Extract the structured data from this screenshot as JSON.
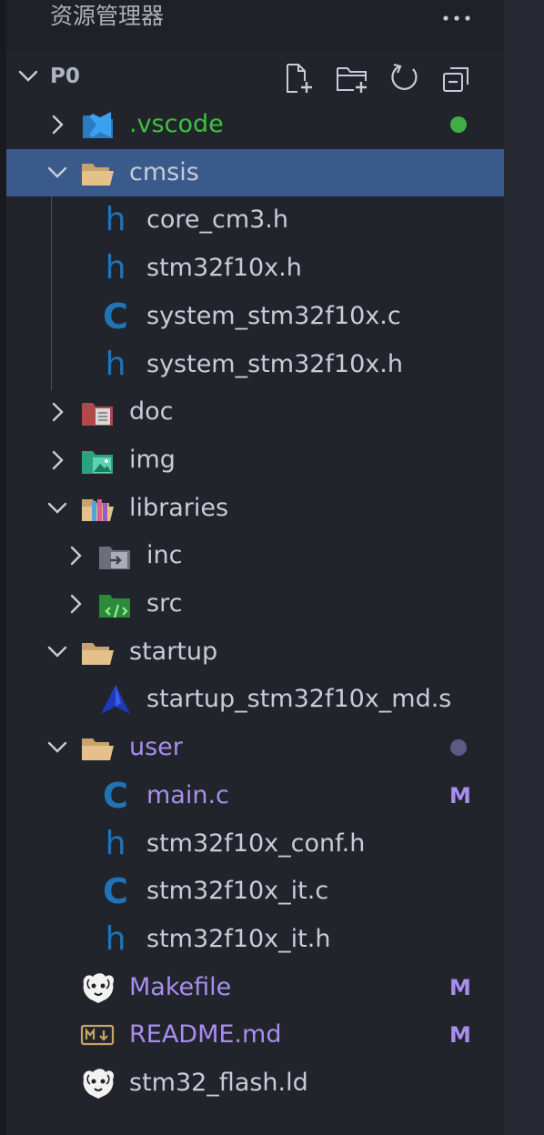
{
  "header": {
    "title": "资源管理器",
    "more_icon": "ellipsis-icon"
  },
  "section": {
    "label": "P0",
    "actions": [
      "new-file-icon",
      "new-folder-icon",
      "refresh-icon",
      "collapse-all-icon"
    ]
  },
  "tree": [
    {
      "label": ".vscode",
      "expanded": false,
      "indent": 1,
      "color": "#3fbf3f",
      "status_dot": "#3fae48",
      "icon": "vscode-folder-icon"
    },
    {
      "label": "cmsis",
      "expanded": true,
      "indent": 1,
      "selected": true,
      "icon": "folder-open-icon"
    },
    {
      "label": "core_cm3.h",
      "indent": 2,
      "icon": "h-file-icon"
    },
    {
      "label": "stm32f10x.h",
      "indent": 2,
      "icon": "h-file-icon"
    },
    {
      "label": "system_stm32f10x.c",
      "indent": 2,
      "icon": "c-file-icon"
    },
    {
      "label": "system_stm32f10x.h",
      "indent": 2,
      "icon": "h-file-icon"
    },
    {
      "label": "doc",
      "expanded": false,
      "indent": 1,
      "icon": "doc-folder-icon"
    },
    {
      "label": "img",
      "expanded": false,
      "indent": 1,
      "icon": "img-folder-icon"
    },
    {
      "label": "libraries",
      "expanded": true,
      "indent": 1,
      "icon": "libraries-folder-icon"
    },
    {
      "label": "inc",
      "expanded": false,
      "indent": 2,
      "icon": "include-folder-icon"
    },
    {
      "label": "src",
      "expanded": false,
      "indent": 2,
      "icon": "src-folder-icon"
    },
    {
      "label": "startup",
      "expanded": true,
      "indent": 1,
      "icon": "folder-open-icon"
    },
    {
      "label": "startup_stm32f10x_md.s",
      "indent": 2,
      "icon": "assembly-file-icon"
    },
    {
      "label": "user",
      "expanded": true,
      "indent": 1,
      "color": "#a98df0",
      "status_dot": "#5d5a86",
      "icon": "folder-open-icon"
    },
    {
      "label": "main.c",
      "indent": 2,
      "color": "#a98df0",
      "badge": "M",
      "icon": "c-file-icon"
    },
    {
      "label": "stm32f10x_conf.h",
      "indent": 2,
      "icon": "h-file-icon"
    },
    {
      "label": "stm32f10x_it.c",
      "indent": 2,
      "icon": "c-file-icon"
    },
    {
      "label": "stm32f10x_it.h",
      "indent": 2,
      "icon": "h-file-icon"
    },
    {
      "label": "Makefile",
      "indent": 1,
      "color": "#a98df0",
      "badge": "M",
      "icon": "gnu-makefile-icon"
    },
    {
      "label": "README.md",
      "indent": 1,
      "color": "#a98df0",
      "badge": "M",
      "icon": "markdown-file-icon"
    },
    {
      "label": "stm32_flash.ld",
      "indent": 1,
      "icon": "gnu-linker-icon"
    }
  ],
  "colors": {
    "selection": "#3b5a8c",
    "default_text": "#c8ccd4",
    "modified": "#a98df0",
    "icon_blue": "#1f73b7"
  }
}
